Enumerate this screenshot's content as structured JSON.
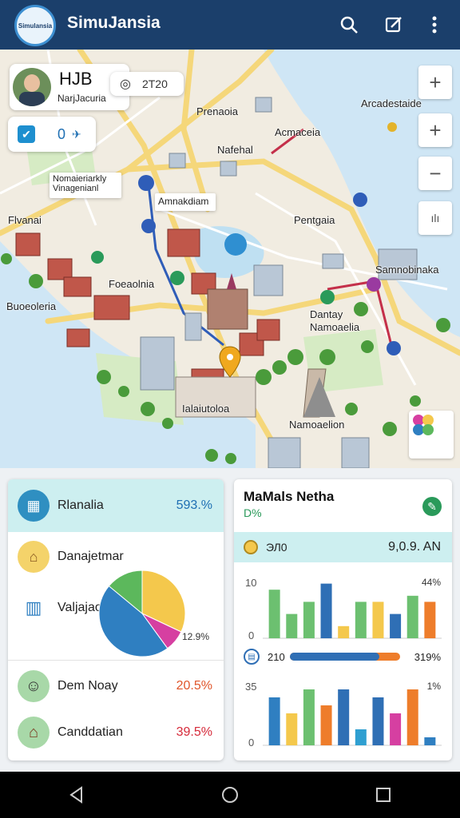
{
  "appbar": {
    "logo_text": "Simulansia",
    "title": "SimuJansia",
    "search_icon": "search-icon",
    "edit_icon": "edit-icon",
    "more_icon": "more-vert-icon"
  },
  "map": {
    "user_card": {
      "name": "HJB",
      "subtitle": "NarjJacuria"
    },
    "badge": {
      "value": "2T20"
    },
    "status": {
      "count": "0"
    },
    "labels": {
      "l1": "Arcadestaide",
      "l2": "Prenaoia",
      "l3": "Acmaceia",
      "l4": "Nafehal",
      "l5": "Nomaieriarkly",
      "l6": "Vinagenianl",
      "l7": "Amnakdiam",
      "l8": "Flvanai",
      "l9": "Pentgaia",
      "l10": "Foeaolnia",
      "l11": "Buoeoleria",
      "l12": "Samnobinaka",
      "l13": "Dantay",
      "l14": "Namoaelia",
      "l15": "Ialaiutoloa",
      "l16": "Namoaelion"
    },
    "controls": {
      "zoom_in": "+",
      "zoom_in_2": "+",
      "zoom_out": "−",
      "layers": "ılı"
    }
  },
  "left_card": {
    "header": {
      "label": "Rlanalia",
      "value": "593.%"
    },
    "rows": [
      {
        "label": "Danajetmar"
      },
      {
        "label": "Valjajaoua"
      }
    ],
    "pie_caption": "12.9%",
    "bottom_rows": [
      {
        "label": "Dem Noay",
        "value": "20.5%"
      },
      {
        "label": "Canddatian",
        "value": "39.5%"
      }
    ]
  },
  "right_card": {
    "title": "MaMals Netha",
    "subtitle": "D%",
    "band": {
      "left": "ЭЛ0",
      "right": "9,0.9. AN"
    },
    "chart1": {
      "ytop": "10",
      "ybottom": "0",
      "right": "44%"
    },
    "progress": {
      "left": "210",
      "right": "319%",
      "value": 0.81
    },
    "chart2": {
      "ytop": "35",
      "ybottom": "0",
      "right": "1%"
    }
  },
  "chart_data": [
    {
      "type": "pie",
      "values": [
        32,
        8,
        46,
        14
      ],
      "colors": [
        "#f4c84c",
        "#d63fa1",
        "#2f7fc1",
        "#5cb85c"
      ],
      "caption": "12.9%"
    },
    {
      "type": "bar",
      "values": [
        8,
        4,
        6,
        9,
        2,
        6,
        6,
        4,
        7,
        6
      ],
      "colors": [
        "#6cc070",
        "#6cc070",
        "#6cc070",
        "#2f6fb5",
        "#f4c84c",
        "#6cc070",
        "#f4c84c",
        "#2f6fb5",
        "#6cc070",
        "#ee7d2b"
      ],
      "ylim": [
        0,
        10
      ]
    },
    {
      "type": "bar",
      "values": [
        6,
        4,
        7,
        5,
        7,
        2,
        6,
        4,
        7,
        1
      ],
      "colors": [
        "#2f7fc1",
        "#f4c84c",
        "#6cc070",
        "#ee7d2b",
        "#2f6fb5",
        "#2f9fd1",
        "#2f6fb5",
        "#d63fa1",
        "#ee7d2b",
        "#2f7fc1"
      ],
      "ylim": [
        0,
        8
      ]
    }
  ],
  "navbar": {
    "back": "back-icon",
    "home": "home-icon",
    "recent": "recent-icon"
  }
}
